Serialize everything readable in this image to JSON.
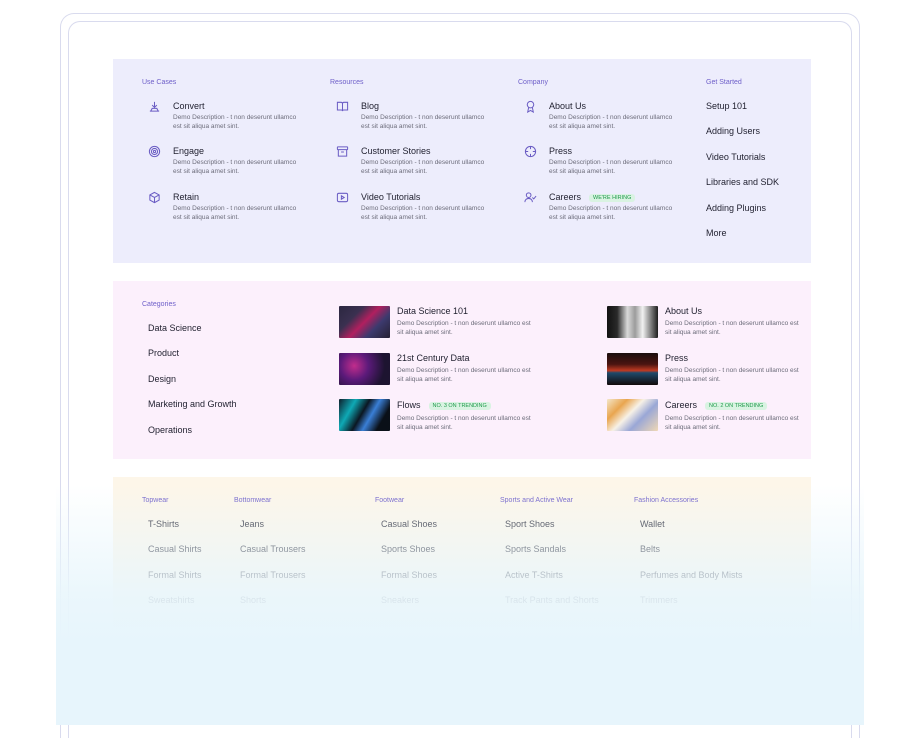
{
  "use_cases": {
    "label": "Use Cases",
    "items": [
      {
        "title": "Convert",
        "desc": "Demo Description - t non deserunt ullamco est sit aliqua amet sint.",
        "icon": "convert-icon"
      },
      {
        "title": "Engage",
        "desc": "Demo Description - t non deserunt ullamco est sit aliqua amet sint.",
        "icon": "target-icon"
      },
      {
        "title": "Retain",
        "desc": "Demo Description - t non deserunt ullamco est sit aliqua amet sint.",
        "icon": "box-icon"
      }
    ]
  },
  "resources": {
    "label": "Resources",
    "items": [
      {
        "title": "Blog",
        "desc": "Demo Description - t non deserunt ullamco est sit aliqua amet sint.",
        "icon": "book-icon"
      },
      {
        "title": "Customer Stories",
        "desc": "Demo Description - t non deserunt ullamco est sit aliqua amet sint.",
        "icon": "archive-icon"
      },
      {
        "title": "Video Tutorials",
        "desc": "Demo Description - t non deserunt ullamco est sit aliqua amet sint.",
        "icon": "play-icon"
      }
    ]
  },
  "company": {
    "label": "Company",
    "items": [
      {
        "title": "About Us",
        "desc": "Demo Description - t non deserunt ullamco est sit aliqua amet sint.",
        "icon": "award-icon"
      },
      {
        "title": "Press",
        "desc": "Demo Description - t non deserunt ullamco est sit aliqua amet sint.",
        "icon": "crosshair-icon"
      },
      {
        "title": "Careers",
        "desc": "Demo Description - t non deserunt ullamco est sit aliqua amet sint.",
        "icon": "user-check-icon",
        "badge": "WE'RE HIRING"
      }
    ]
  },
  "get_started": {
    "label": "Get Started",
    "links": [
      "Setup 101",
      "Adding Users",
      "Video Tutorials",
      "Libraries and SDK",
      "Adding Plugins",
      "More"
    ]
  },
  "categories": {
    "label": "Categories",
    "items": [
      "Data Science",
      "Product",
      "Design",
      "Marketing and Growth",
      "Operations"
    ]
  },
  "featured_left": [
    {
      "title": "Data Science 101",
      "desc": "Demo Description - t non deserunt ullamco est sit aliqua amet sint."
    },
    {
      "title": "21st Century Data",
      "desc": "Demo Description - t non deserunt ullamco est sit aliqua amet sint."
    },
    {
      "title": "Flows",
      "desc": "Demo Description - t non deserunt ullamco est sit aliqua amet sint.",
      "badge": "NO. 3 ON TRENDING"
    }
  ],
  "featured_right": [
    {
      "title": "About Us",
      "desc": "Demo Description - t non deserunt ullamco est sit aliqua amet sint."
    },
    {
      "title": "Press",
      "desc": "Demo Description - t non deserunt ullamco est sit aliqua amet sint."
    },
    {
      "title": "Careers",
      "desc": "Demo Description - t non deserunt ullamco est sit aliqua amet sint.",
      "badge": "NO. 2 ON TRENDING"
    }
  ],
  "shop": {
    "topwear": {
      "label": "Topwear",
      "links": [
        "T-Shirts",
        "Casual Shirts",
        "Formal Shirts",
        "Sweatshirts"
      ]
    },
    "bottomwear": {
      "label": "Bottomwear",
      "links": [
        "Jeans",
        "Casual Trousers",
        "Formal Trousers",
        "Shorts"
      ]
    },
    "footwear": {
      "label": "Footwear",
      "links": [
        "Casual Shoes",
        "Sports Shoes",
        "Formal Shoes",
        "Sneakers"
      ]
    },
    "sports": {
      "label": "Sports and Active Wear",
      "links": [
        "Sport Shoes",
        "Sports Sandals",
        "Active T-Shirts",
        "Track Pants and Shorts"
      ]
    },
    "accessories": {
      "label": "Fashion Accessories",
      "links": [
        "Wallet",
        "Belts",
        "Perfumes and Body Mists",
        "Trimmers"
      ]
    }
  },
  "colors": {
    "accent": "#6b5dc4",
    "panel_blue": "#ededfc",
    "panel_pink": "#fcf0fc",
    "panel_cream": "#fdf6e9",
    "badge_green": "#1f9a4b"
  }
}
